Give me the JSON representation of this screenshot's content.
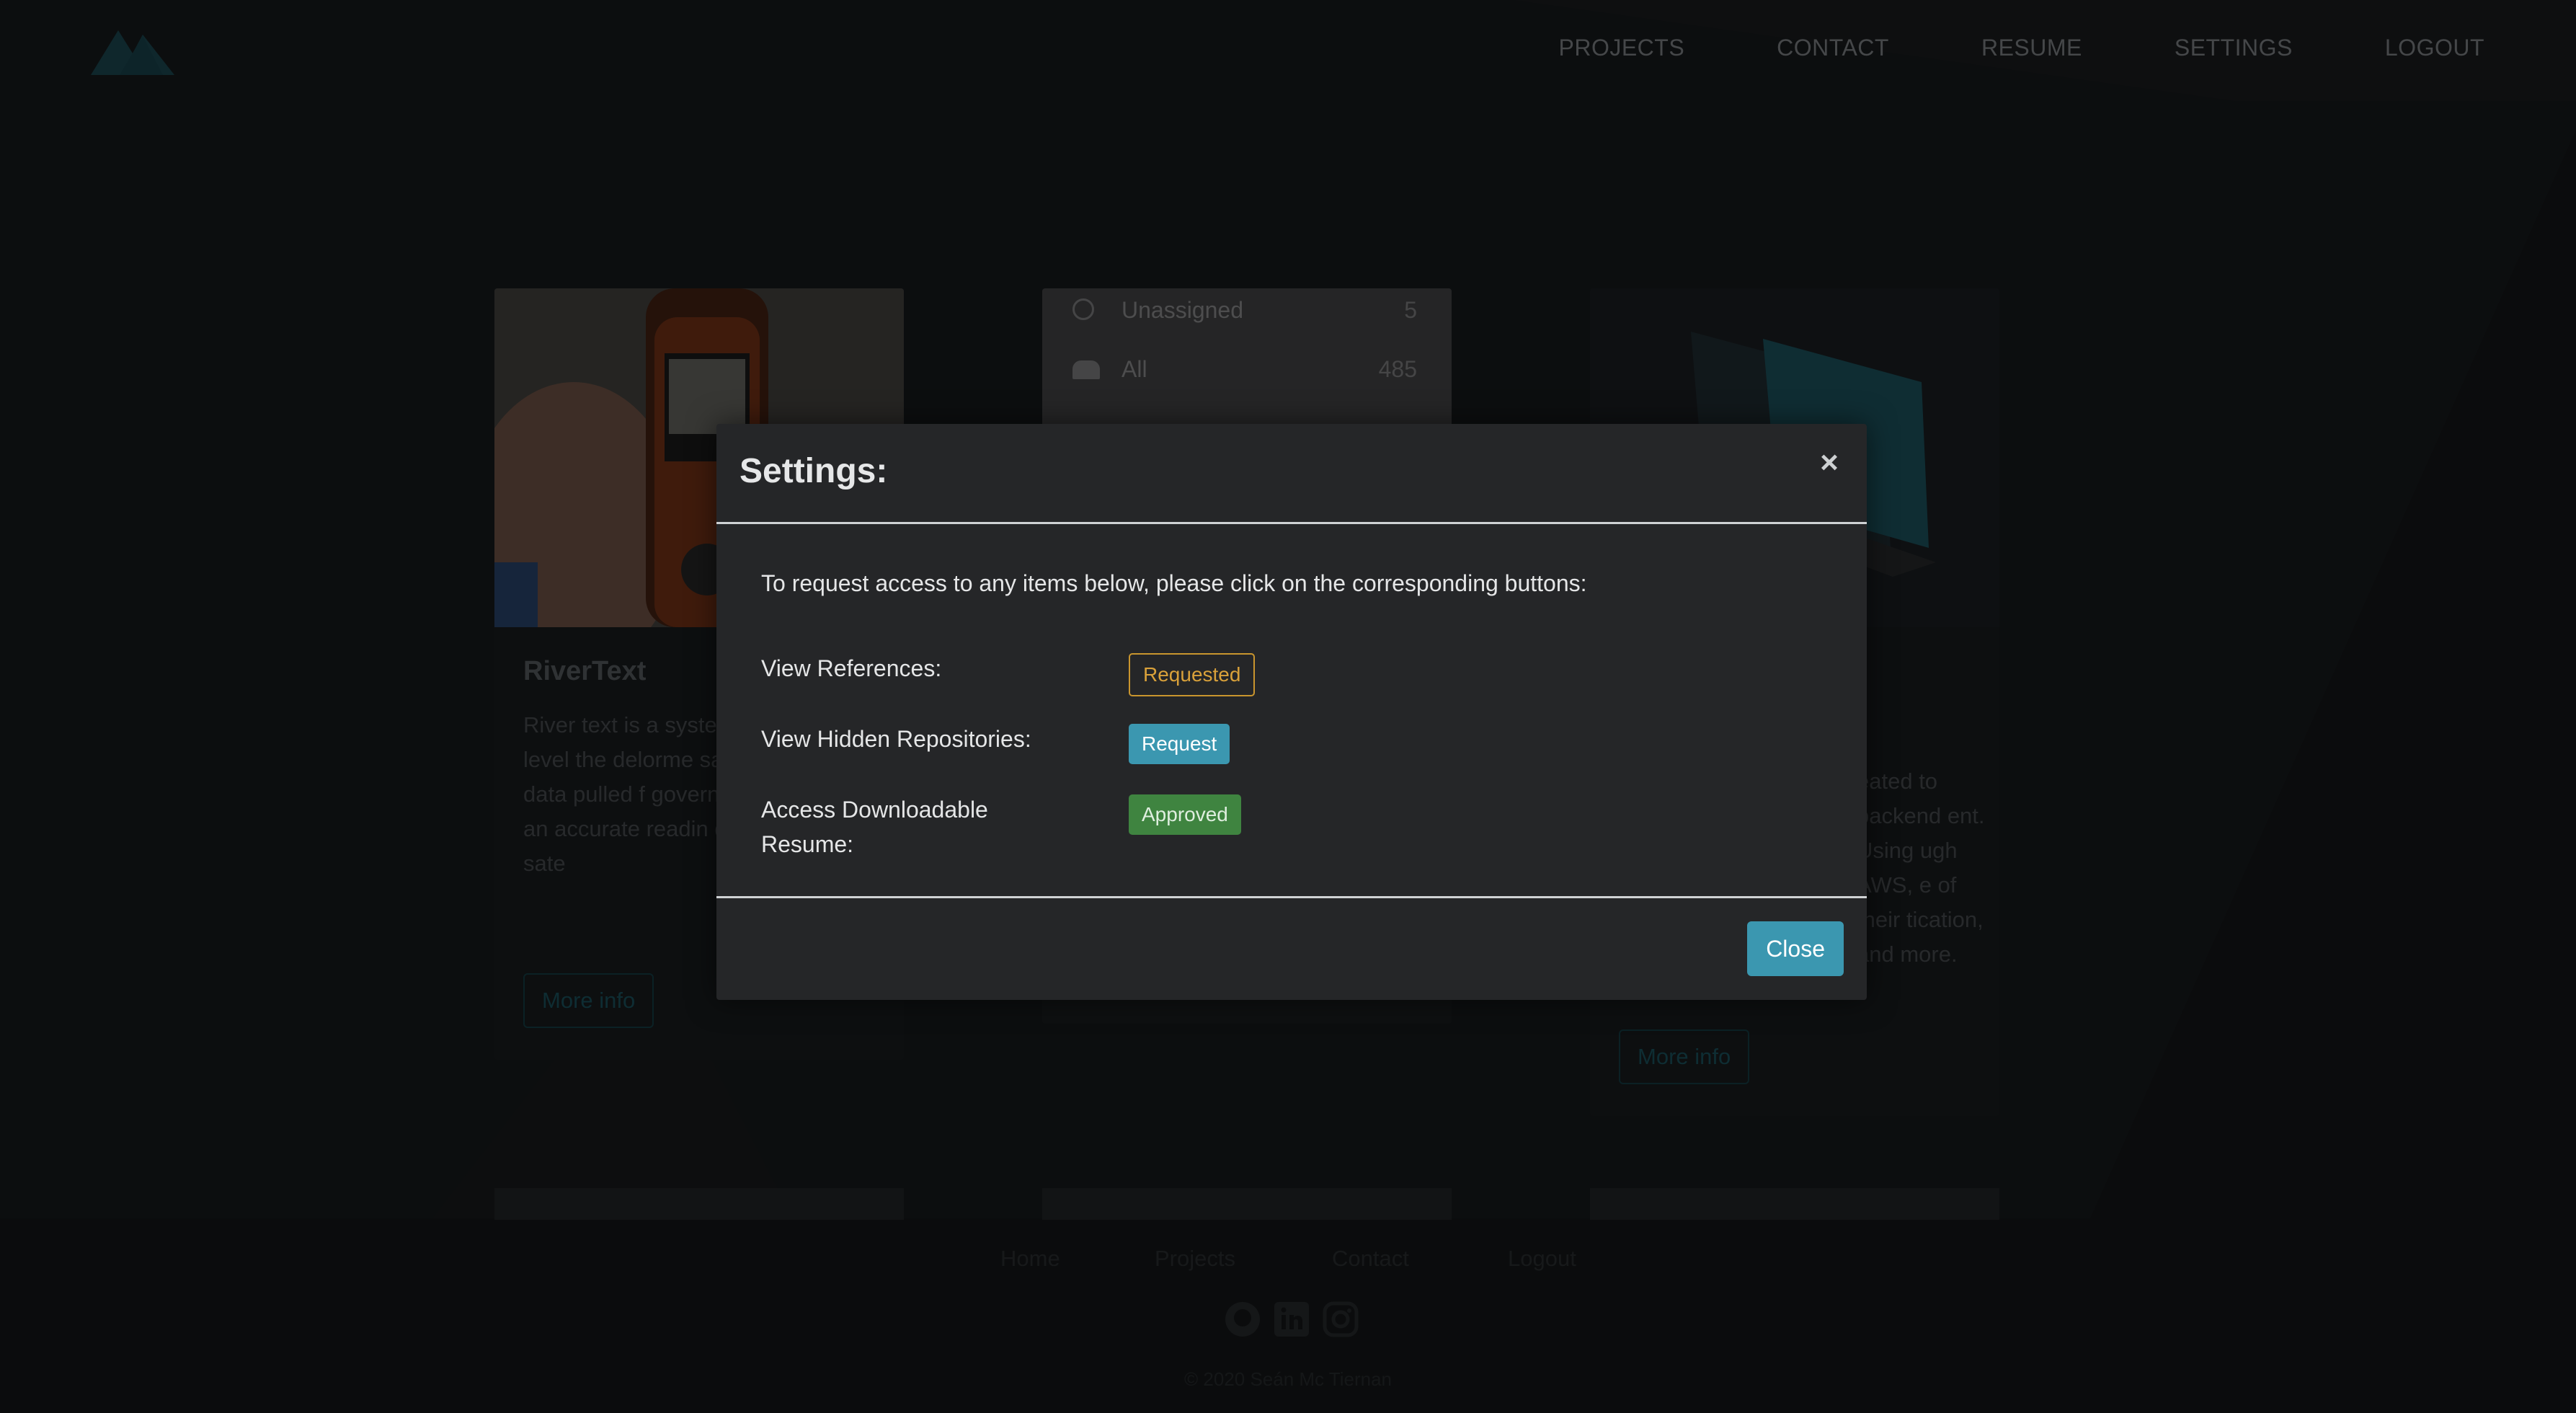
{
  "nav": {
    "items": [
      {
        "label": "PROJECTS"
      },
      {
        "label": "CONTACT"
      },
      {
        "label": "RESUME"
      },
      {
        "label": "SETTINGS"
      },
      {
        "label": "LOGOUT"
      }
    ]
  },
  "cards": [
    {
      "title": "RiverText",
      "text": "River text is a syste help get river level the delorme satelit Using data pulled f government of Ca an accurate readin directly to the sate",
      "button": "More info"
    },
    {
      "list": [
        {
          "label": "Unassigned",
          "count": "5"
        },
        {
          "label": "All",
          "count": "485"
        }
      ]
    },
    {
      "text": "eated to backend ent. Using ugh AWS, e of their tication, and more.",
      "button": "More info"
    }
  ],
  "footer": {
    "links": [
      "Home",
      "Projects",
      "Contact",
      "Logout"
    ],
    "copyright": "© 2020 Seán Mc Tiernan",
    "social": [
      "github-icon",
      "linkedin-icon",
      "instagram-icon"
    ]
  },
  "modal": {
    "title": "Settings:",
    "close_glyph": "×",
    "intro": "To request access to any items below, please click on the corresponding buttons:",
    "rows": [
      {
        "label": "View References:",
        "status": "Requested"
      },
      {
        "label": "View Hidden Repositories:",
        "status": "Request"
      },
      {
        "label": "Access Downloadable Resume:",
        "status": "Approved"
      }
    ],
    "close_button": "Close"
  },
  "colors": {
    "accent": "#3b97b0",
    "requested": "#c9952e",
    "approved": "#3f8440"
  }
}
